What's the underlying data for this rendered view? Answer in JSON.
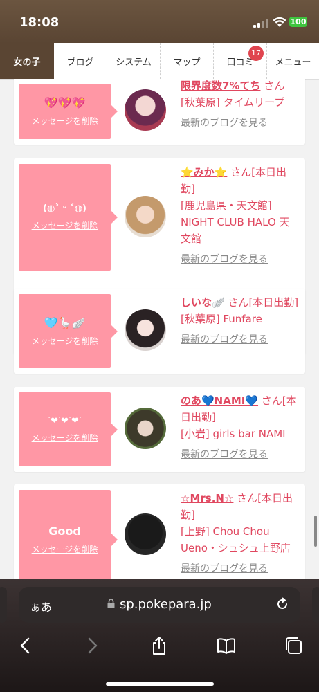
{
  "status": {
    "time": "18:08",
    "battery": "100"
  },
  "nav": {
    "tabs": [
      {
        "label": "女の子",
        "active": true
      },
      {
        "label": "ブログ"
      },
      {
        "label": "システム"
      },
      {
        "label": "マップ"
      },
      {
        "label": "口コミ",
        "badge": "17"
      },
      {
        "label": "メニュー"
      }
    ]
  },
  "cards": [
    {
      "message": "💖💖💖",
      "delete_label": "メッセージを削除",
      "name": "限界度数7%てち",
      "suffix": " さん",
      "shop": "[秋葉原] タイムリープ",
      "blog_link": "最新のブログを見る"
    },
    {
      "message": "(◍˃ ᵕ ˂◍)",
      "delete_label": "メッセージを削除",
      "name": "⭐みか⭐",
      "suffix": " さん[本日出勤]",
      "shop": "[鹿児島県・天文館] NIGHT CLUB HALO 天文館",
      "blog_link": "最新のブログを見る"
    },
    {
      "message": "🩵🪿🪽",
      "delete_label": "メッセージを削除",
      "name": "しいな🪽",
      "suffix": " さん[本日出勤]",
      "shop": "[秋葉原] Funfare",
      "blog_link": "最新のブログを見る"
    },
    {
      "message": "ᐝ❤︎ᐝ❤︎ᐝ❤︎ᐝ",
      "delete_label": "メッセージを削除",
      "name": "のあ💙NAMI💙",
      "suffix": " さん[本日出勤]",
      "shop": "[小岩] girls bar NAMI",
      "blog_link": "最新のブログを見る"
    },
    {
      "message": "Good",
      "delete_label": "メッセージを削除",
      "name": "☆Mrs.N☆",
      "suffix": " さん[本日出勤]",
      "shop": "[上野] Chou Chou Ueno・シュシュ上野店",
      "blog_link": "最新のブログを見る"
    }
  ],
  "browser": {
    "aa_label": "ぁあ",
    "url": "sp.pokepara.jp"
  },
  "colors": {
    "accent_pink": "#ff97a5",
    "name_pink": "#e0475f",
    "nav_brown": "#5a4533"
  },
  "icons": [
    "signal-icon",
    "wifi-icon",
    "battery-icon",
    "lock-icon",
    "reload-icon",
    "back-icon",
    "forward-icon",
    "share-icon",
    "bookmarks-icon",
    "tabs-icon"
  ]
}
